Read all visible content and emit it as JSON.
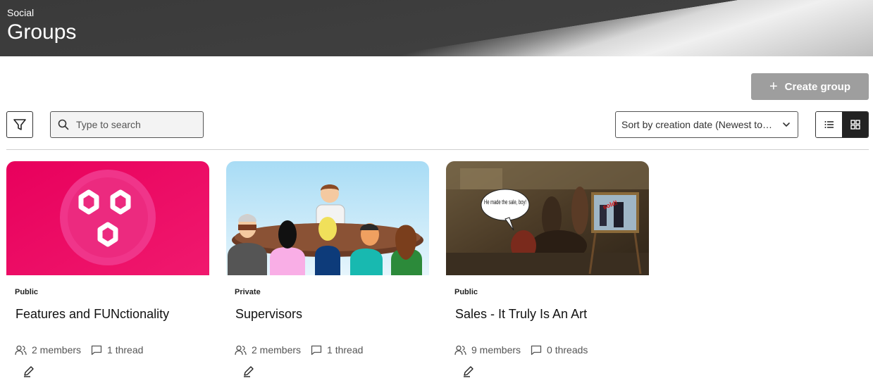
{
  "header": {
    "subtitle": "Social",
    "title": "Groups"
  },
  "toolbar": {
    "create_label": "Create group",
    "search_placeholder": "Type to search",
    "sort_label": "Sort by creation date (Newest to oldest)"
  },
  "groups": [
    {
      "visibility": "Public",
      "name": "Features and FUNctionality",
      "members": "2 members",
      "threads": "1 thread",
      "image": "features-hexagons-logo"
    },
    {
      "visibility": "Private",
      "name": "Supervisors",
      "members": "2 members",
      "threads": "1 thread",
      "image": "meeting-table-illustration"
    },
    {
      "visibility": "Public",
      "name": "Sales - It Truly Is An Art",
      "members": "9 members",
      "threads": "0 threads",
      "image": "sales-painting",
      "image_caption": "He made the sale, boy!",
      "image_stamp": "sold!"
    }
  ],
  "colors": {
    "accent_dark": "#222222",
    "button_disabled": "#9e9e9e",
    "features_pink": "#e6005f"
  }
}
